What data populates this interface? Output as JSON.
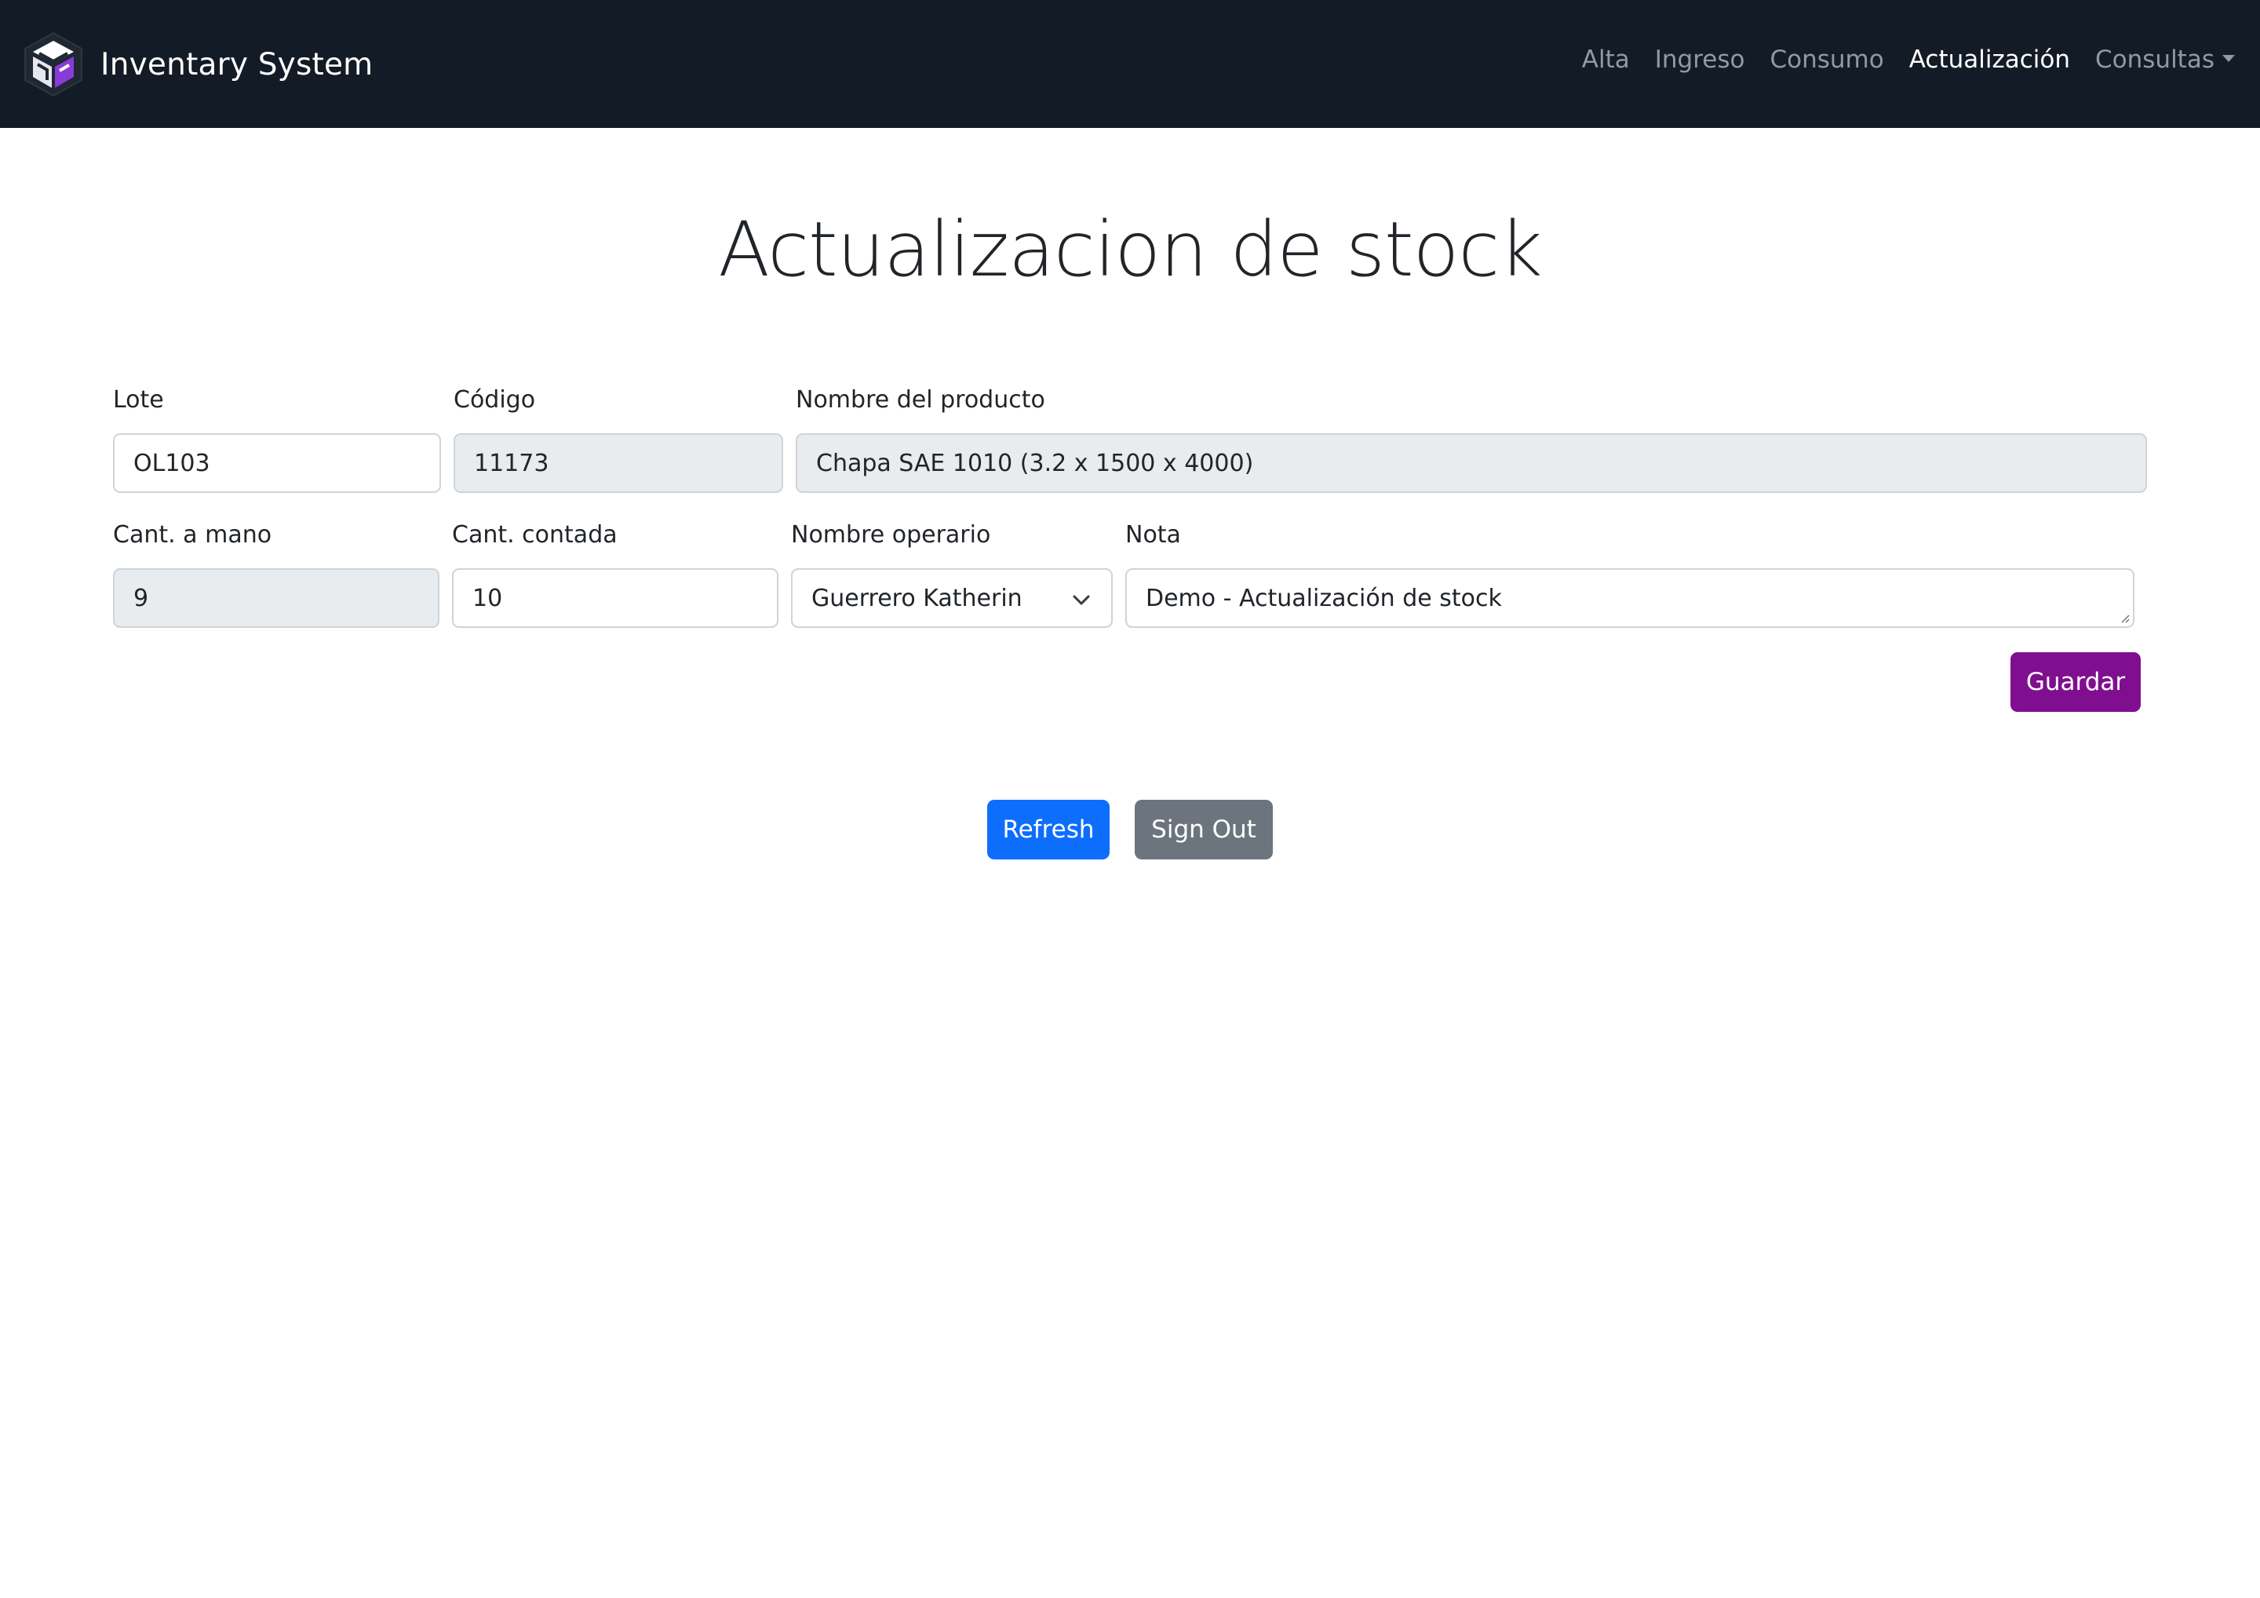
{
  "brand": {
    "name": "Inventary System",
    "logo_icon": "cube-logo-icon"
  },
  "nav": {
    "items": [
      {
        "label": "Alta",
        "active": false
      },
      {
        "label": "Ingreso",
        "active": false
      },
      {
        "label": "Consumo",
        "active": false
      },
      {
        "label": "Actualización",
        "active": true
      },
      {
        "label": "Consultas",
        "active": false,
        "dropdown": true
      }
    ]
  },
  "page": {
    "title": "Actualizacion de stock"
  },
  "form": {
    "lote": {
      "label": "Lote",
      "value": "OL103"
    },
    "codigo": {
      "label": "Código",
      "value": "11173"
    },
    "nombre_producto": {
      "label": "Nombre del producto",
      "value": "Chapa SAE 1010 (3.2 x 1500 x 4000)"
    },
    "cant_mano": {
      "label": "Cant. a mano",
      "value": "9"
    },
    "cant_contada": {
      "label": "Cant. contada",
      "value": "10"
    },
    "nombre_operario": {
      "label": "Nombre operario",
      "value": "Guerrero Katherin"
    },
    "nota": {
      "label": "Nota",
      "value": "Demo - Actualización de stock"
    },
    "save_label": "Guardar"
  },
  "actions": {
    "refresh_label": "Refresh",
    "signout_label": "Sign Out"
  },
  "colors": {
    "navbar_bg": "#131b26",
    "guardar": "#800f8f",
    "refresh": "#0d6efd",
    "signout": "#6c757d",
    "disabled_bg": "#e9ecef"
  }
}
